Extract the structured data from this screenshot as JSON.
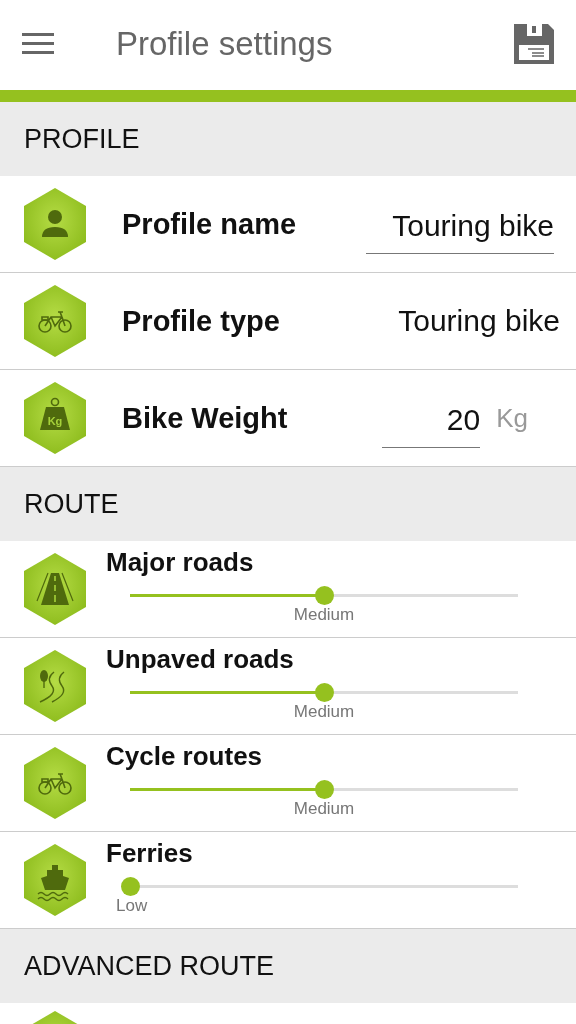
{
  "app_bar": {
    "title": "Profile settings"
  },
  "sections": [
    {
      "title": "PROFILE",
      "items": [
        {
          "kind": "text-field",
          "label": "Profile name",
          "value": "Touring bike"
        },
        {
          "kind": "value",
          "label": "Profile type",
          "value": "Touring bike"
        },
        {
          "kind": "number-field",
          "icon_text": "Kg",
          "label": "Bike Weight",
          "value": "20",
          "unit": "Kg"
        }
      ]
    },
    {
      "title": "ROUTE",
      "items": [
        {
          "kind": "slider",
          "label": "Major roads",
          "level": 0.5,
          "reading": "Medium"
        },
        {
          "kind": "slider",
          "label": "Unpaved roads",
          "level": 0.5,
          "reading": "Medium"
        },
        {
          "kind": "slider",
          "label": "Cycle routes",
          "level": 0.5,
          "reading": "Medium"
        },
        {
          "kind": "slider",
          "label": "Ferries",
          "level": 0,
          "reading": "Low"
        }
      ]
    },
    {
      "title": "ADVANCED ROUTE",
      "items": [
        {
          "kind": "cut-off"
        }
      ]
    }
  ]
}
